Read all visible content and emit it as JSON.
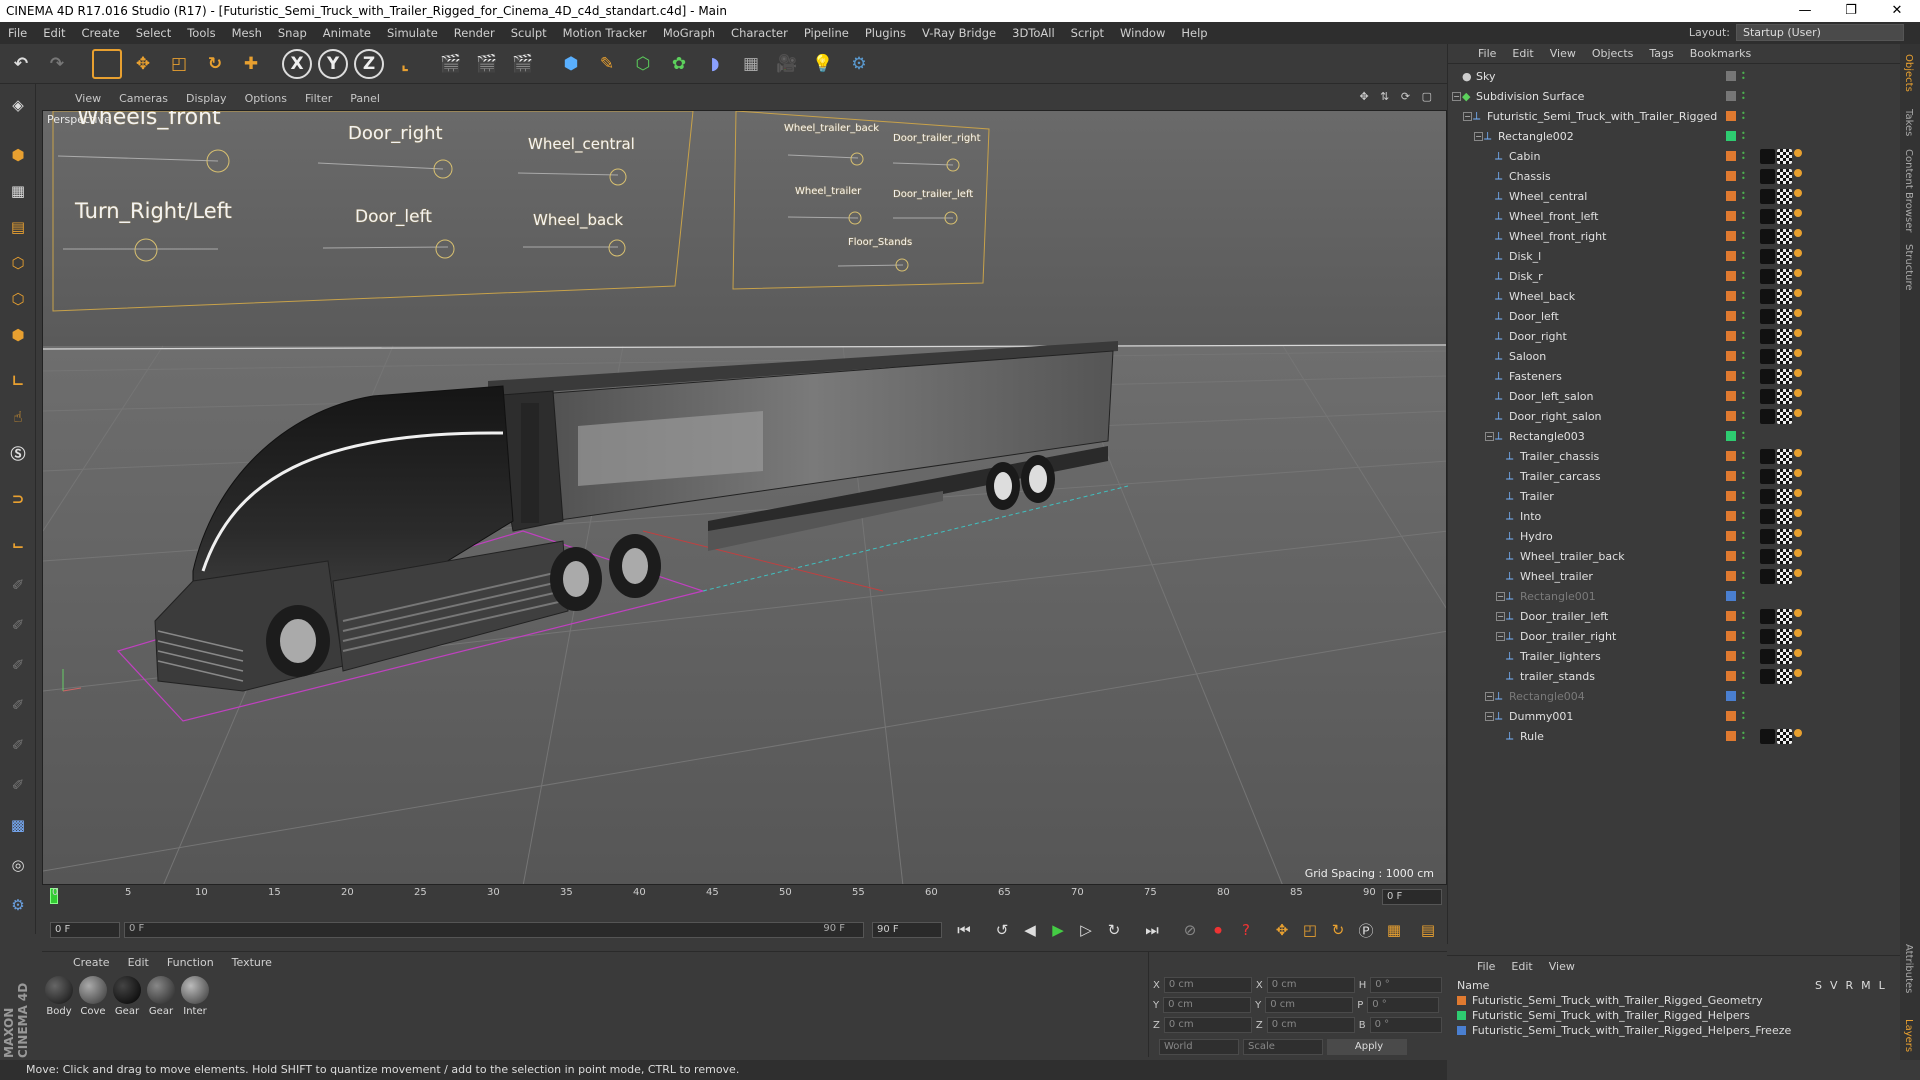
{
  "window": {
    "title": "CINEMA 4D R17.016 Studio (R17) - [Futuristic_Semi_Truck_with_Trailer_Rigged_for_Cinema_4D_c4d_standart.c4d] - Main",
    "minimize": "—",
    "maximize": "❐",
    "close": "✕"
  },
  "menu": [
    "File",
    "Edit",
    "Create",
    "Select",
    "Tools",
    "Mesh",
    "Snap",
    "Animate",
    "Simulate",
    "Render",
    "Sculpt",
    "Motion Tracker",
    "MoGraph",
    "Character",
    "Pipeline",
    "Plugins",
    "V-Ray Bridge",
    "3DToAll",
    "Script",
    "Window",
    "Help"
  ],
  "layout": {
    "label": "Layout:",
    "value": "Startup (User)"
  },
  "toolbar": {
    "undo": "↶",
    "redo": "↷",
    "x": "X",
    "y": "Y",
    "z": "Z"
  },
  "viewport": {
    "menu": [
      "View",
      "Cameras",
      "Display",
      "Options",
      "Filter",
      "Panel"
    ],
    "label": "Perspective",
    "grid_spacing": "Grid Spacing : 1000 cm",
    "nav": "✥ ⇅ ⟳ ▢"
  },
  "rig": {
    "left": [
      "Wheels_front",
      "Door_right",
      "Wheel_central",
      "Turn_Right/Left",
      "Door_left",
      "Wheel_back"
    ],
    "right": [
      "Wheel_trailer_back",
      "Door_trailer_right",
      "Wheel_trailer",
      "Door_trailer_left",
      "Floor_Stands"
    ]
  },
  "timeline": {
    "ticks": [
      "0",
      "5",
      "10",
      "15",
      "20",
      "25",
      "30",
      "35",
      "40",
      "45",
      "50",
      "55",
      "60",
      "65",
      "70",
      "75",
      "80",
      "85",
      "90"
    ],
    "frame_right": "0 F"
  },
  "playback": {
    "start": "0 F",
    "range_start": "0 F",
    "range_end": "90 F",
    "end": "90 F"
  },
  "materials": {
    "menu": [
      "Create",
      "Edit",
      "Function",
      "Texture"
    ],
    "items": [
      "Body",
      "Cove",
      "Gear",
      "Gear",
      "Inter"
    ]
  },
  "coords": {
    "x": "X",
    "y": "Y",
    "z": "Z",
    "x_val": "0 cm",
    "y_val": "0 cm",
    "z_val": "0 cm",
    "x2": "X",
    "y2": "Y",
    "z2": "Z",
    "x2_val": "0 cm",
    "y2_val": "0 cm",
    "z2_val": "0 cm",
    "h": "H",
    "p": "P",
    "b": "B",
    "h_val": "0 °",
    "p_val": "0 °",
    "b_val": "0 °",
    "world": "World",
    "scale": "Scale",
    "apply": "Apply"
  },
  "status": "Move: Click and drag to move elements. Hold SHIFT to quantize movement / add to the selection in point mode, CTRL to remove.",
  "objects": {
    "menu": [
      "File",
      "Edit",
      "View",
      "Objects",
      "Tags",
      "Bookmarks"
    ],
    "rows": [
      {
        "name": "Sky",
        "indent": 0
      },
      {
        "name": "Subdivision Surface",
        "indent": 0
      },
      {
        "name": "Futuristic_Semi_Truck_with_Trailer_Rigged",
        "indent": 1
      },
      {
        "name": "Rectangle002",
        "indent": 2
      },
      {
        "name": "Cabin",
        "indent": 3
      },
      {
        "name": "Chassis",
        "indent": 3
      },
      {
        "name": "Wheel_central",
        "indent": 3
      },
      {
        "name": "Wheel_front_left",
        "indent": 3
      },
      {
        "name": "Wheel_front_right",
        "indent": 3
      },
      {
        "name": "Disk_l",
        "indent": 3
      },
      {
        "name": "Disk_r",
        "indent": 3
      },
      {
        "name": "Wheel_back",
        "indent": 3
      },
      {
        "name": "Door_left",
        "indent": 3
      },
      {
        "name": "Door_right",
        "indent": 3
      },
      {
        "name": "Saloon",
        "indent": 3
      },
      {
        "name": "Fasteners",
        "indent": 3
      },
      {
        "name": "Door_left_salon",
        "indent": 3
      },
      {
        "name": "Door_right_salon",
        "indent": 3
      },
      {
        "name": "Rectangle003",
        "indent": 3
      },
      {
        "name": "Trailer_chassis",
        "indent": 4
      },
      {
        "name": "Trailer_carcass",
        "indent": 4
      },
      {
        "name": "Trailer",
        "indent": 4
      },
      {
        "name": "Into",
        "indent": 4
      },
      {
        "name": "Hydro",
        "indent": 4
      },
      {
        "name": "Wheel_trailer_back",
        "indent": 4
      },
      {
        "name": "Wheel_trailer",
        "indent": 4
      },
      {
        "name": "Rectangle001",
        "indent": 4
      },
      {
        "name": "Door_trailer_left",
        "indent": 4
      },
      {
        "name": "Door_trailer_right",
        "indent": 4
      },
      {
        "name": "Trailer_lighters",
        "indent": 4
      },
      {
        "name": "trailer_stands",
        "indent": 4
      },
      {
        "name": "Rectangle004",
        "indent": 3
      },
      {
        "name": "Dummy001",
        "indent": 3
      },
      {
        "name": "Rule",
        "indent": 4
      }
    ]
  },
  "layers": {
    "menu": [
      "File",
      "Edit",
      "View"
    ],
    "header_name": "Name",
    "cols": [
      "S",
      "V",
      "R",
      "M",
      "L"
    ],
    "items": [
      "Futuristic_Semi_Truck_with_Trailer_Rigged_Geometry",
      "Futuristic_Semi_Truck_with_Trailer_Rigged_Helpers",
      "Futuristic_Semi_Truck_with_Trailer_Rigged_Helpers_Freeze"
    ],
    "colors": [
      "#e07a30",
      "#2ecc71",
      "#4a7fd0"
    ]
  },
  "side_tabs": [
    "Objects",
    "Takes",
    "Content Browser",
    "Structure",
    "Attributes",
    "Layers"
  ],
  "logo": "MAXON CINEMA 4D"
}
